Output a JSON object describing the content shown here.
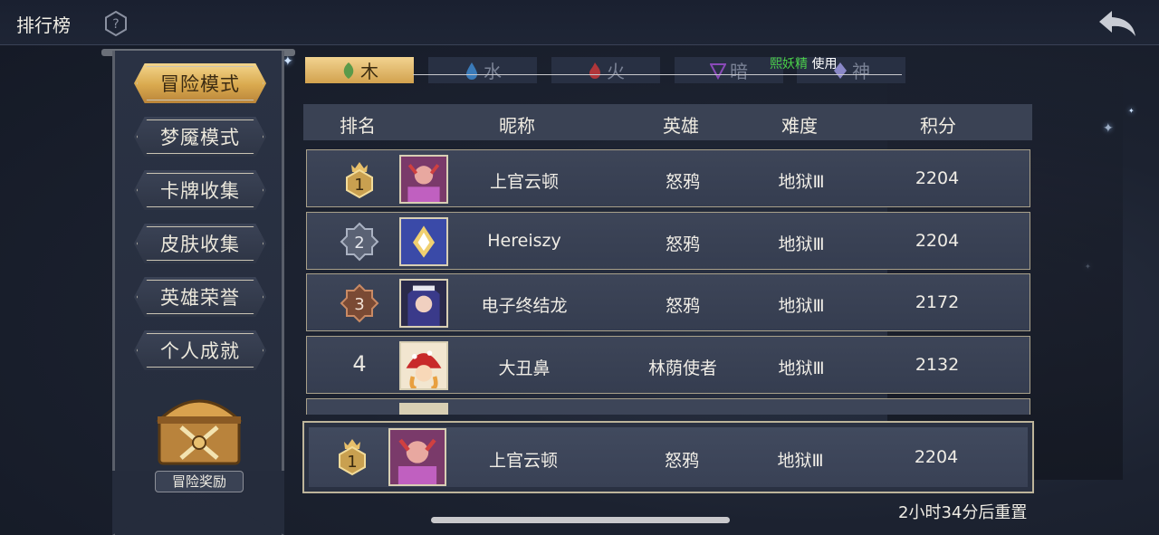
{
  "header": {
    "title": "排行榜"
  },
  "sidebar": {
    "modes": [
      "冒险模式",
      "梦魇模式",
      "卡牌收集",
      "皮肤收集",
      "英雄荣誉",
      "个人成就"
    ],
    "active_index": 0,
    "reward_label": "冒险奖励"
  },
  "tabs": [
    {
      "label": "木",
      "icon": "leaf-icon"
    },
    {
      "label": "水",
      "icon": "water-drop-icon"
    },
    {
      "label": "火",
      "icon": "flame-icon"
    },
    {
      "label": "暗",
      "icon": "dark-sigil-icon"
    },
    {
      "label": "神",
      "icon": "divine-crystal-icon"
    }
  ],
  "notice": {
    "name": "熙妖精",
    "action": "使用"
  },
  "table": {
    "headers": {
      "rank": "排名",
      "nickname": "昵称",
      "hero": "英雄",
      "difficulty": "难度",
      "score": "积分"
    },
    "rows": [
      {
        "rank": "1",
        "name": "上官云顿",
        "hero": "怒鸦",
        "difficulty": "地狱Ⅲ",
        "score": "2204"
      },
      {
        "rank": "2",
        "name": "Hereiszy",
        "hero": "怒鸦",
        "difficulty": "地狱Ⅲ",
        "score": "2204"
      },
      {
        "rank": "3",
        "name": "电子终结龙",
        "hero": "怒鸦",
        "difficulty": "地狱Ⅲ",
        "score": "2172"
      },
      {
        "rank": "4",
        "name": "大丑鼻",
        "hero": "林荫使者",
        "difficulty": "地狱Ⅲ",
        "score": "2132"
      }
    ],
    "my_row": {
      "rank": "1",
      "name": "上官云顿",
      "hero": "怒鸦",
      "difficulty": "地狱Ⅲ",
      "score": "2204"
    }
  },
  "footer": {
    "reset_text": "2小时34分后重置"
  },
  "colors": {
    "gold": "#d9a94e",
    "silver": "#9aa4b8",
    "bronze": "#b0704a",
    "panel": "#3a4254"
  }
}
